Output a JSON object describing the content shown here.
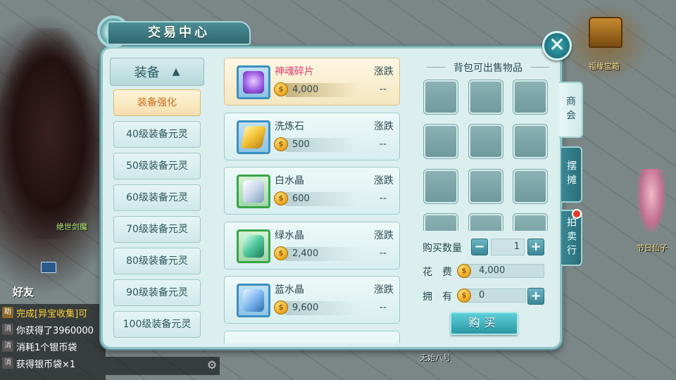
{
  "scene": {
    "chest_label": "福缘宝箱",
    "fairy_label": "节日仙子",
    "left_label": "绝世剑魔",
    "bottom_label": "无始八号"
  },
  "panel": {
    "title": "交易中心",
    "close_symbol": "✕"
  },
  "categories": {
    "header": "装备",
    "caret": "▲",
    "items": [
      {
        "label": "装备强化",
        "active": true
      },
      {
        "label": "40级装备元灵"
      },
      {
        "label": "50级装备元灵"
      },
      {
        "label": "60级装备元灵"
      },
      {
        "label": "70级装备元灵"
      },
      {
        "label": "80级装备元灵"
      },
      {
        "label": "90级装备元灵"
      },
      {
        "label": "100级装备元灵"
      }
    ]
  },
  "items": [
    {
      "name": "神魂碎片",
      "price": "4,000",
      "trend_label": "涨跌",
      "trend": "--",
      "icon": "soul-shard-icon",
      "color": "#b07ae8"
    },
    {
      "name": "洗炼石",
      "price": "500",
      "trend_label": "涨跌",
      "trend": "--",
      "icon": "refine-stone-icon",
      "color": "#f2c233"
    },
    {
      "name": "白水晶",
      "price": "600",
      "trend_label": "涨跌",
      "trend": "--",
      "icon": "white-crystal-icon",
      "color": "#d9e6f2"
    },
    {
      "name": "绿水晶",
      "price": "2,400",
      "trend_label": "涨跌",
      "trend": "--",
      "icon": "green-crystal-icon",
      "color": "#4fc79a"
    },
    {
      "name": "蓝水晶",
      "price": "9,600",
      "trend_label": "涨跌",
      "trend": "--",
      "icon": "blue-crystal-icon",
      "color": "#7fb8f0"
    }
  ],
  "sell": {
    "title": "背包可出售物品"
  },
  "purchase": {
    "qty_label": "购买数量",
    "qty_value": "1",
    "cost_label": "花　费",
    "cost_value": "4,000",
    "own_label": "拥　有",
    "own_value": "0",
    "buy_label": "购买",
    "minus": "−",
    "plus": "+"
  },
  "tabs": [
    {
      "label": "商会",
      "active": true
    },
    {
      "label": "摆摊"
    },
    {
      "label": "拍卖行"
    }
  ],
  "chat": {
    "friends": "好友",
    "rows": [
      {
        "tag": "助",
        "text": "完成[异宝收集]可"
      },
      {
        "tag": "消",
        "text": "你获得了3960000"
      },
      {
        "tag": "消",
        "text": "消耗1个银币袋"
      },
      {
        "tag": "消",
        "text": "获得银币袋×1"
      }
    ]
  },
  "coin_glyph": "$",
  "colors": {
    "accent": "#2a97a4",
    "selected_item_name": "#e2386a",
    "active_category": "#c86e1c"
  }
}
